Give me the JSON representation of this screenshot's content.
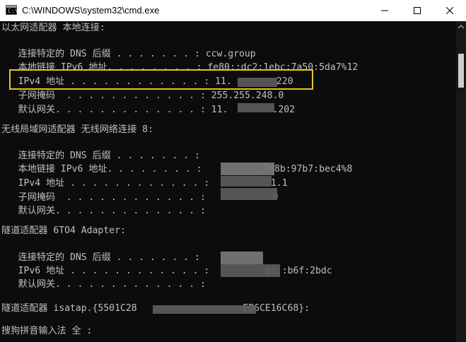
{
  "window": {
    "title": "C:\\WINDOWS\\system32\\cmd.exe",
    "icon": "console-icon",
    "icon_glyph": "C:\\",
    "controls": [
      "minimize-icon",
      "maximize-icon",
      "close-icon"
    ]
  },
  "colors": {
    "background": "#0c0c0c",
    "text": "#c0c0c0",
    "titlebar": "#ffffff",
    "highlight": "#e8c227"
  },
  "lines": [
    "以太网适配器 本地连接:",
    "",
    "   连接特定的 DNS 后缀 . . . . . . . : ccw.group",
    "   本地链接 IPv6 地址. . . . . . . . : fe80::dc2:1ebc:7a50:5da7%12",
    "   IPv4 地址 . . . . . . . . . . . . : 11.        220",
    "   子网掩码  . . . . . . . . . . . . : 255.255.248.0",
    "   默认网关. . . . . . . . . . . . . : 11.        .202",
    "",
    "无线局域网适配器 无线网络连接 8:",
    "",
    "   连接特定的 DNS 后缀 . . . . . . . :",
    "   本地链接 IPv6 地址. . . . . . . . :          :7d8b:97b7:bec4%8",
    "   IPv4 地址 . . . . . . . . . . . . :           1.1",
    "   子网掩码  . . . . . . . . . . . . :           .0",
    "   默认网关. . . . . . . . . . . . . :",
    "",
    "隧道适配器 6TO4 Adapter:",
    "",
    "   连接特定的 DNS 后缀 . . . . . . . :",
    "   IPv6 地址 . . . . . . . . . . . . :          dc::b6f:2bdc",
    "   默认网关. . . . . . . . . . . . . :",
    "",
    "隧道适配器 isatap.{5501C28                   EB6CE16C68}:",
    "",
    "搜狗拼音输入法 全 :"
  ]
}
